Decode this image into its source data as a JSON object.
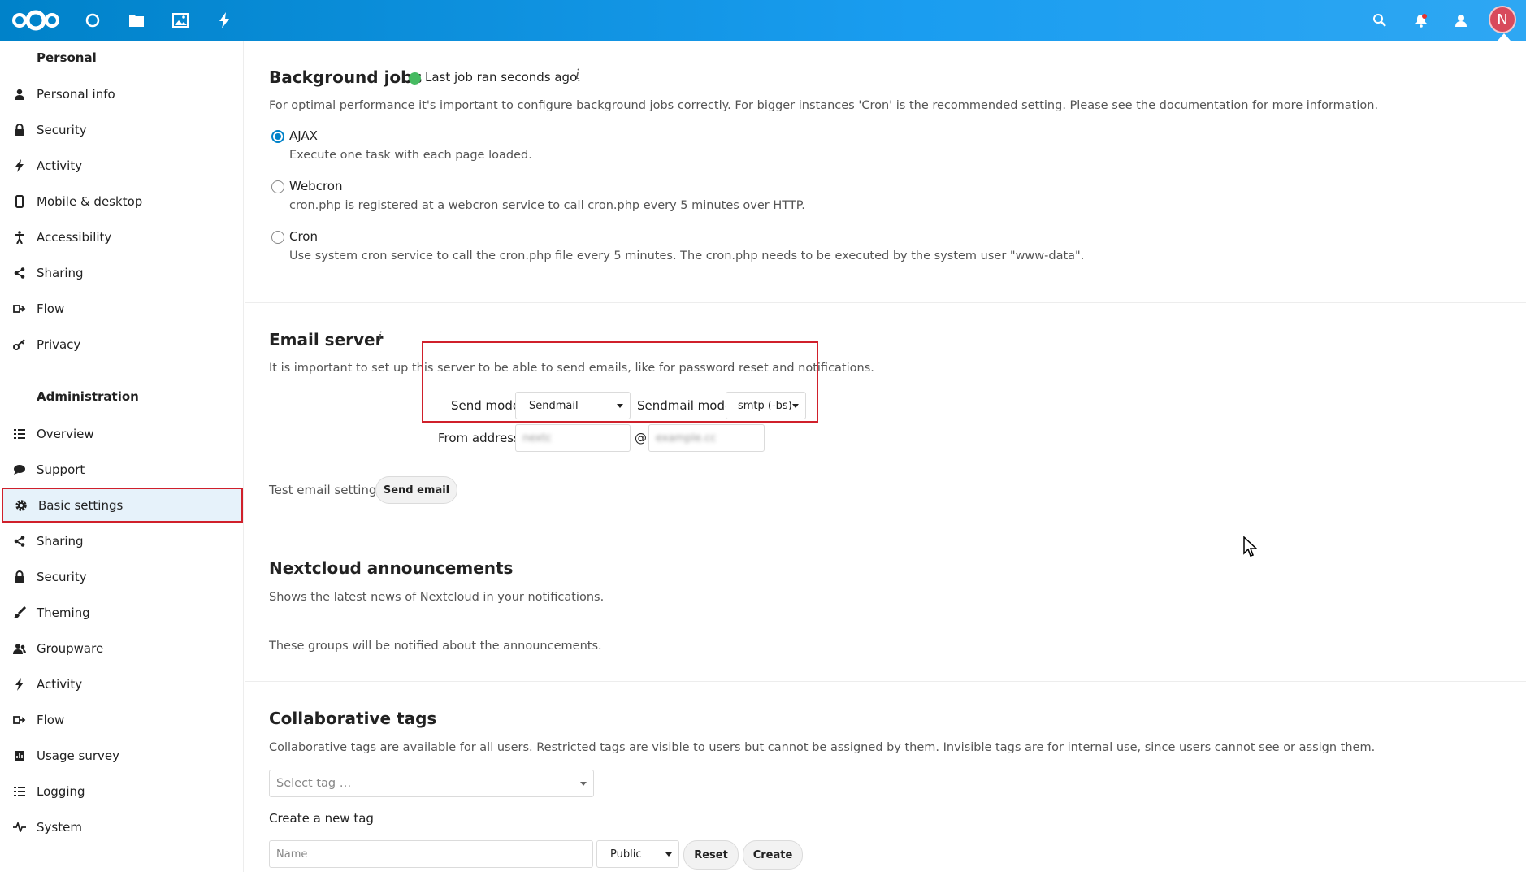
{
  "header": {
    "apps": [
      {
        "name": "dashboard-icon",
        "label": "Dashboard"
      },
      {
        "name": "files-icon",
        "label": "Files"
      },
      {
        "name": "photos-icon",
        "label": "Photos"
      },
      {
        "name": "activity-icon",
        "label": "Activity"
      }
    ],
    "avatar_initial": "N",
    "accent_color": "#0082c9"
  },
  "sidebar": {
    "personal_caption": "Personal",
    "personal_items": [
      {
        "label": "Personal info",
        "icon": "user-icon"
      },
      {
        "label": "Security",
        "icon": "lock-icon"
      },
      {
        "label": "Activity",
        "icon": "lightning-icon"
      },
      {
        "label": "Mobile & desktop",
        "icon": "phone-icon"
      },
      {
        "label": "Accessibility",
        "icon": "accessibility-icon"
      },
      {
        "label": "Sharing",
        "icon": "share-icon"
      },
      {
        "label": "Flow",
        "icon": "flow-icon"
      },
      {
        "label": "Privacy",
        "icon": "key-icon"
      }
    ],
    "admin_caption": "Administration",
    "admin_items": [
      {
        "label": "Overview",
        "icon": "list-icon"
      },
      {
        "label": "Support",
        "icon": "chat-icon"
      },
      {
        "label": "Basic settings",
        "icon": "gear-icon"
      },
      {
        "label": "Sharing",
        "icon": "share-icon"
      },
      {
        "label": "Security",
        "icon": "lock-icon"
      },
      {
        "label": "Theming",
        "icon": "brush-icon"
      },
      {
        "label": "Groupware",
        "icon": "group-icon"
      },
      {
        "label": "Activity",
        "icon": "lightning-icon"
      },
      {
        "label": "Flow",
        "icon": "flow-icon"
      },
      {
        "label": "Usage survey",
        "icon": "survey-icon"
      },
      {
        "label": "Logging",
        "icon": "list-icon"
      },
      {
        "label": "System",
        "icon": "pulse-icon"
      }
    ]
  },
  "background_jobs": {
    "title": "Background jobs",
    "status": "Last job ran seconds ago.",
    "description": "For optimal performance it's important to configure background jobs correctly. For bigger instances 'Cron' is the recommended setting. Please see the documentation for more information.",
    "options": [
      {
        "label": "AJAX",
        "desc": "Execute one task with each page loaded.",
        "checked": true
      },
      {
        "label": "Webcron",
        "desc": "cron.php is registered at a webcron service to call cron.php every 5 minutes over HTTP.",
        "checked": false
      },
      {
        "label": "Cron",
        "desc": "Use system cron service to call the cron.php file every 5 minutes. The cron.php needs to be executed by the system user \"www-data\".",
        "checked": false
      }
    ]
  },
  "email_server": {
    "title": "Email server",
    "description": "It is important to set up this server to be able to send emails, like for password reset and notifications.",
    "send_mode_label": "Send mode",
    "send_mode_value": "Sendmail",
    "sendmail_mode_label": "Sendmail mode",
    "sendmail_mode_value": "smtp (-bs)",
    "from_address_label": "From address",
    "from_user_value": "nextc",
    "at_sign": "@",
    "from_domain_value": "example.cc",
    "test_label": "Test email settings",
    "send_button": "Send email"
  },
  "announcements": {
    "title": "Nextcloud announcements",
    "description": "Shows the latest news of Nextcloud in your notifications.",
    "groups_text": "These groups will be notified about the announcements."
  },
  "collab_tags": {
    "title": "Collaborative tags",
    "description": "Collaborative tags are available for all users. Restricted tags are visible to users but cannot be assigned by them. Invisible tags are for internal use, since users cannot see or assign them.",
    "select_placeholder": "Select tag …",
    "create_label": "Create a new tag",
    "name_placeholder": "Name",
    "visibility_value": "Public",
    "reset_button": "Reset",
    "create_button": "Create"
  }
}
